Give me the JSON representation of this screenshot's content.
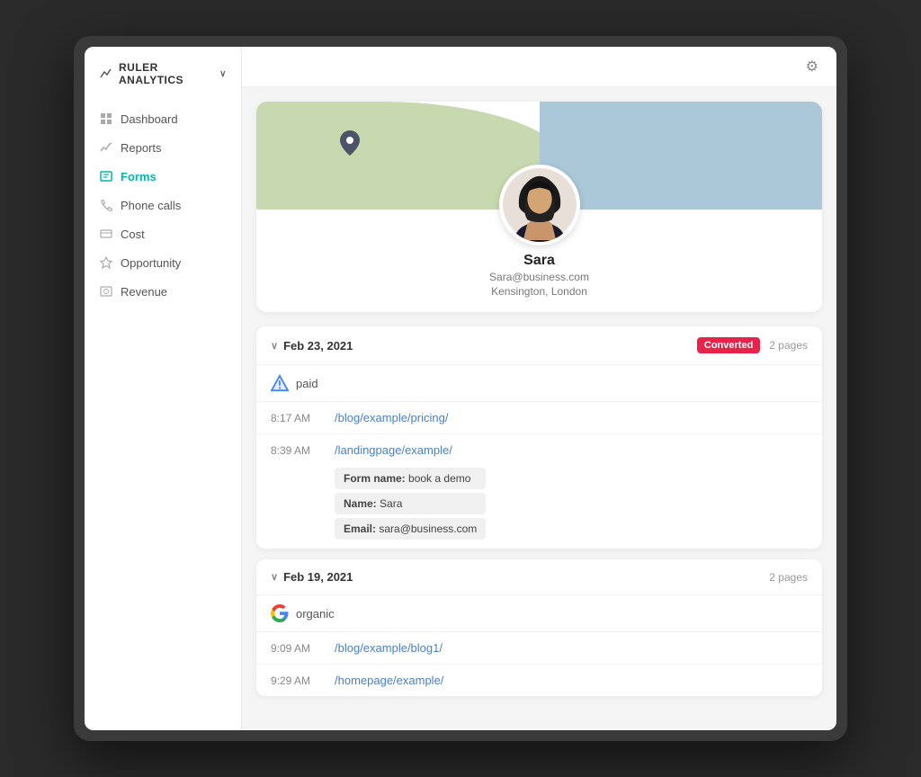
{
  "brand": {
    "logo_label": "RULER ANALYTICS",
    "chevron": "∨"
  },
  "sidebar": {
    "items": [
      {
        "id": "dashboard",
        "label": "Dashboard",
        "active": false
      },
      {
        "id": "reports",
        "label": "Reports",
        "active": false
      },
      {
        "id": "forms",
        "label": "Forms",
        "active": true
      },
      {
        "id": "phone",
        "label": "Phone calls",
        "active": false
      },
      {
        "id": "cost",
        "label": "Cost",
        "active": false
      },
      {
        "id": "opportunity",
        "label": "Opportunity",
        "active": false
      },
      {
        "id": "revenue",
        "label": "Revenue",
        "active": false
      }
    ]
  },
  "profile": {
    "name": "Sara",
    "email": "Sara@business.com",
    "location": "Kensington, London"
  },
  "sessions": [
    {
      "id": "session1",
      "date": "Feb 23, 2021",
      "converted": true,
      "converted_label": "Converted",
      "pages": "2 pages",
      "source": "paid",
      "rows": [
        {
          "time": "8:17 AM",
          "url": "/blog/example/pricing/",
          "form": null
        },
        {
          "time": "8:39 AM",
          "url": "/landingpage/example/",
          "form": {
            "form_name_label": "Form name:",
            "form_name_value": "book a demo",
            "name_label": "Name:",
            "name_value": "Sara",
            "email_label": "Email:",
            "email_value": "sara@business.com"
          }
        }
      ]
    },
    {
      "id": "session2",
      "date": "Feb 19, 2021",
      "converted": false,
      "pages": "2 pages",
      "source": "organic",
      "rows": [
        {
          "time": "9:09 AM",
          "url": "/blog/example/blog1/",
          "form": null
        },
        {
          "time": "9:29 AM",
          "url": "/homepage/example/",
          "form": null
        }
      ]
    }
  ],
  "icons": {
    "gear": "⚙",
    "chevron_down": "∨",
    "pin": "📍",
    "dashboard_icon": "▦",
    "reports_icon": "📊",
    "forms_icon": "✏",
    "phone_icon": "📞",
    "cost_icon": "💲",
    "opportunity_icon": "⧖",
    "revenue_icon": "📺"
  }
}
